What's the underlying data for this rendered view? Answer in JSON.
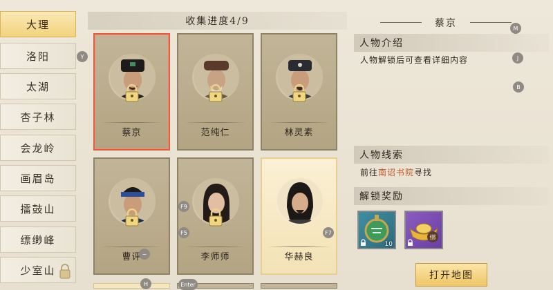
{
  "regions": [
    "大理",
    "洛阳",
    "太湖",
    "杏子林",
    "会龙岭",
    "画眉岛",
    "擂鼓山",
    "缥缈峰",
    "少室山"
  ],
  "active_region": "大理",
  "progress_text": "收集进度4/9",
  "characters": [
    {
      "name": "蔡京",
      "locked": true,
      "selected": true
    },
    {
      "name": "范纯仁",
      "locked": true,
      "selected": false
    },
    {
      "name": "林灵素",
      "locked": true,
      "selected": false
    },
    {
      "name": "曹评",
      "locked": true,
      "selected": false
    },
    {
      "name": "李师师",
      "locked": true,
      "selected": false
    },
    {
      "name": "华赫良",
      "locked": false,
      "selected": false
    }
  ],
  "detail": {
    "name": "蔡京",
    "intro_title": "人物介绍",
    "intro_text": "人物解锁后可查看详细内容",
    "clue_title": "人物线索",
    "clue_prefix": "前往",
    "clue_place": "南诏书院",
    "clue_suffix": "寻找",
    "reward_title": "解锁奖励"
  },
  "rewards": [
    {
      "icon": "jade-token-icon",
      "count": "10"
    },
    {
      "icon": "gold-ingot-icon",
      "label": "绑"
    }
  ],
  "open_map_label": "打开地图",
  "key_hints": {
    "y": "Y",
    "m": "M",
    "j": "J",
    "b": "B",
    "h": "H",
    "f9": "F9",
    "f5": "F5",
    "f7": "F7",
    "enter": "Enter"
  },
  "colors": {
    "accent_gold": "#f1d27e",
    "selected_border": "#e25d42",
    "link": "#c0552b"
  }
}
